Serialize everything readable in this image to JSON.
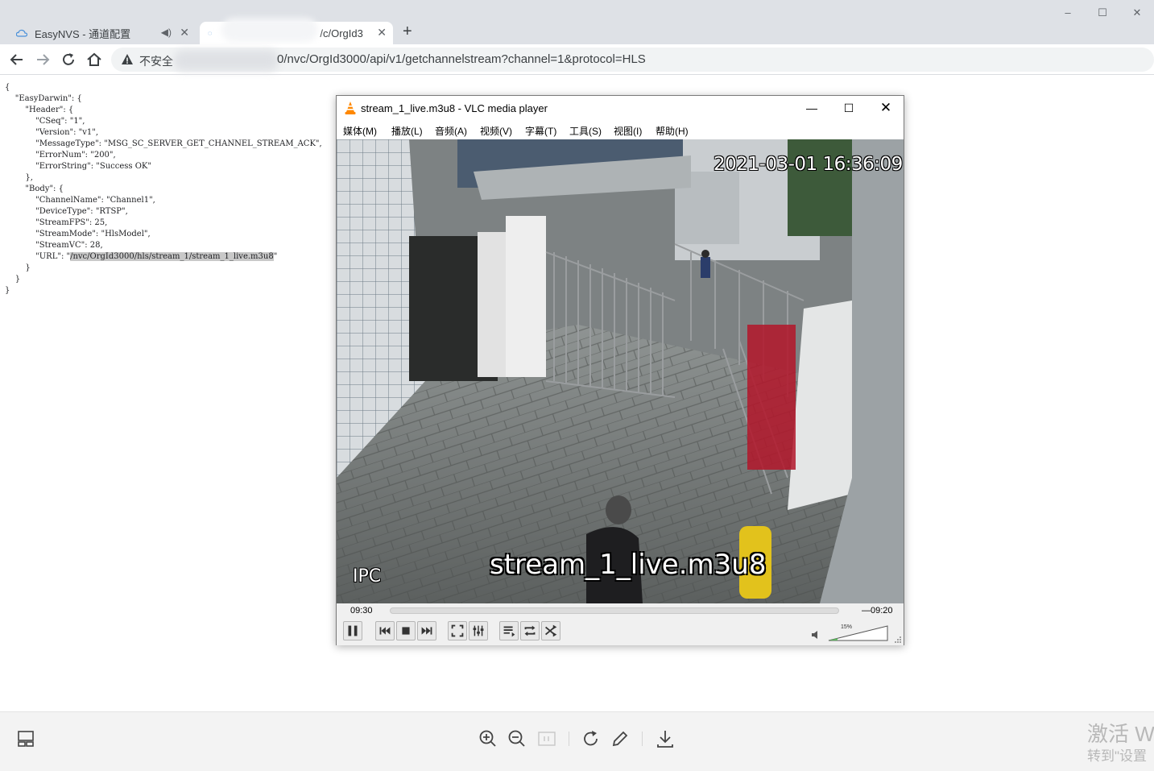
{
  "browser": {
    "tabs": [
      {
        "title": "EasyNVS - 通道配置",
        "active": false
      },
      {
        "title": "/c/OrgId3",
        "active": true
      }
    ],
    "new_tab_label": "+",
    "window_controls": {
      "minimize": "–",
      "maximize": "☐",
      "close": "✕"
    },
    "security_label": "不安全",
    "url": "0/nvc/OrgId3000/api/v1/getchannelstream?channel=1&protocol=HLS"
  },
  "json_page": {
    "lines": [
      "{",
      "    \"EasyDarwin\": {",
      "        \"Header\": {",
      "            \"CSeq\": \"1\",",
      "            \"Version\": \"v1\",",
      "            \"MessageType\": \"MSG_SC_SERVER_GET_CHANNEL_STREAM_ACK\",",
      "            \"ErrorNum\": \"200\",",
      "            \"ErrorString\": \"Success OK\"",
      "        },",
      "        \"Body\": {",
      "            \"ChannelName\": \"Channel1\",",
      "            \"DeviceType\": \"RTSP\",",
      "            \"StreamFPS\": 25,",
      "            \"StreamMode\": \"HlsModel\",",
      "            \"StreamVC\": 28,"
    ],
    "url_line_prefix": "            \"URL\": \"",
    "url_line_value": "/nvc/OrgId3000/hls/stream_1/stream_1_live.m3u8",
    "url_line_suffix": "\"",
    "closing_lines": [
      "        }",
      "    }",
      "}"
    ]
  },
  "vlc": {
    "title": "stream_1_live.m3u8 - VLC media player",
    "menu": [
      "媒体(M)",
      "播放(L)",
      "音频(A)",
      "视频(V)",
      "字幕(T)",
      "工具(S)",
      "视图(I)",
      "帮助(H)"
    ],
    "video": {
      "timestamp": "2021-03-01 16:36:09",
      "camera_label": "IPC",
      "osd_title": "stream_1_live.m3u8"
    },
    "time_elapsed": "09:30",
    "time_remaining": "—09:20",
    "volume_label": "15%",
    "volume": 0.15,
    "controls": [
      "pause",
      "previous",
      "stop",
      "next",
      "fullscreen",
      "extended-settings",
      "playlist",
      "loop",
      "random"
    ]
  },
  "bottom_toolbar": {
    "icons": [
      "layout-icon",
      "zoom-in-icon",
      "zoom-out-icon",
      "actual-size-icon",
      "rotate-icon",
      "annotate-icon",
      "download-icon"
    ]
  },
  "watermark": {
    "line1": "激活 W",
    "line2": "转到\"设置"
  },
  "colors": {
    "tabstrip": "#dee1e6",
    "omnibox": "#f1f3f4",
    "vlc_orange": "#ff8800",
    "json_highlight": "#c8c8c8"
  }
}
